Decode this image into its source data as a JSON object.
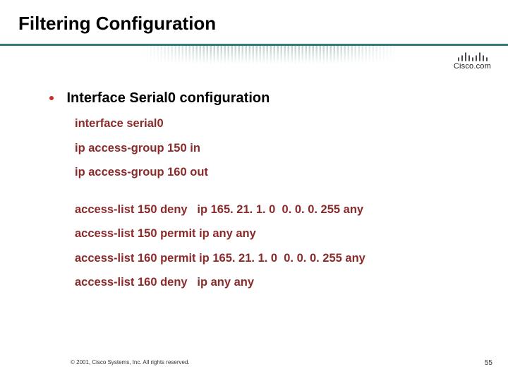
{
  "title": "Filtering Configuration",
  "logo_text": "Cisco.com",
  "bullet": "Interface Serial0 configuration",
  "config": {
    "block1": [
      "interface serial0",
      "ip access-group 150 in",
      "ip access-group 160 out"
    ],
    "block2": [
      "access-list 150 deny   ip 165. 21. 1. 0  0. 0. 0. 255 any",
      "access-list 150 permit ip any any",
      "access-list 160 permit ip 165. 21. 1. 0  0. 0. 0. 255 any",
      "access-list 160 deny   ip any any"
    ]
  },
  "copyright": "© 2001, Cisco Systems, Inc. All rights reserved.",
  "page_number": "55"
}
